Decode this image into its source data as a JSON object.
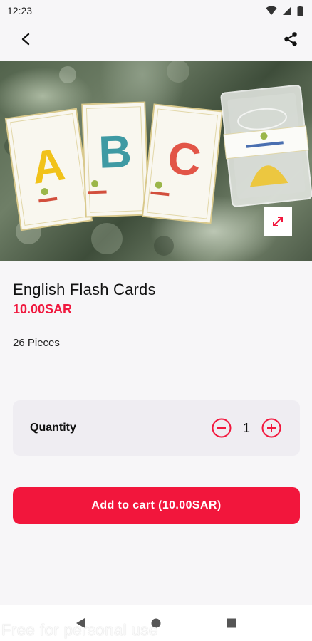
{
  "status_bar": {
    "time": "12:23",
    "icons": [
      "wifi-icon",
      "signal-icon",
      "battery-icon"
    ]
  },
  "app_bar": {
    "icons": [
      "back-arrow-icon",
      "share-icon"
    ]
  },
  "product": {
    "image_cards": [
      "A",
      "B",
      "C"
    ],
    "name": "English Flash Cards",
    "price": "10.00SAR",
    "description": "26 Pieces"
  },
  "quantity": {
    "label": "Quantity",
    "value": "1"
  },
  "cart": {
    "button_label": "Add to cart (10.00SAR)"
  },
  "watermark": "Free for personal use",
  "colors": {
    "accent": "#f2163c",
    "price": "#f0193f",
    "card_bg": "#efedf2",
    "page_bg": "#f7f6f8"
  }
}
